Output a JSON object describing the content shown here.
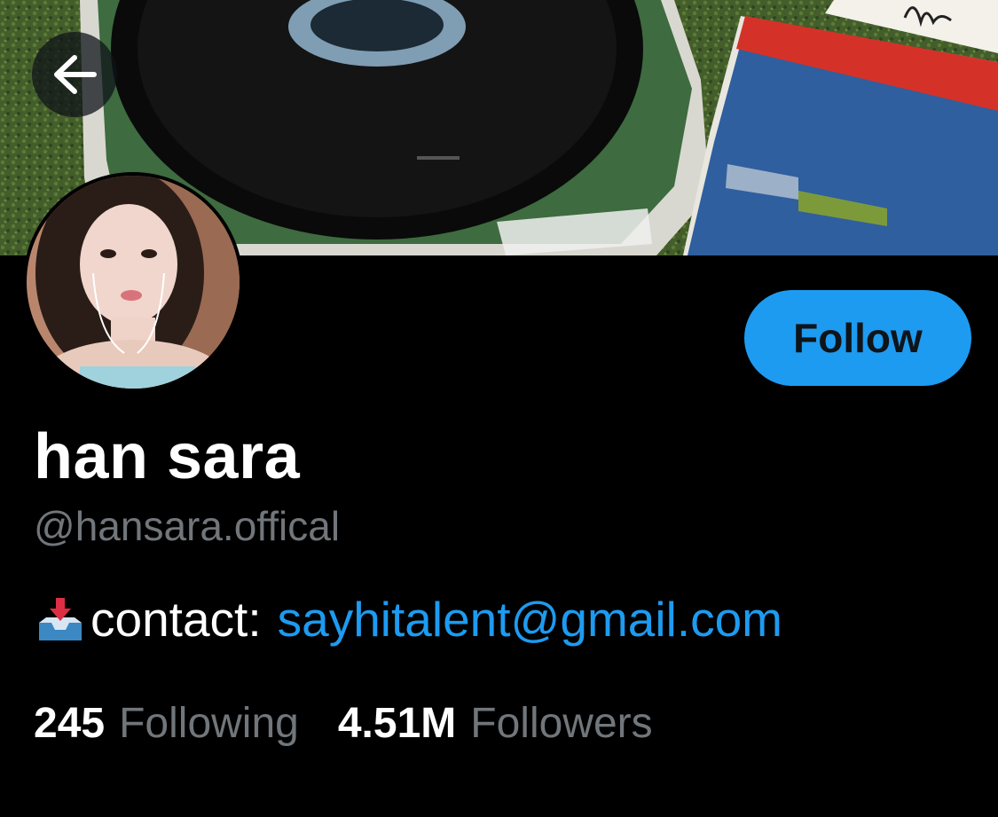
{
  "header": {
    "back_icon": "arrow-left-icon"
  },
  "banner": {
    "description_colors": {
      "grass": "#3f5a2a",
      "record": "#0b0b0b",
      "card_blue": "#3a6fb8",
      "card_red": "#d9322b"
    }
  },
  "profile": {
    "display_name": "han sara",
    "handle": "@hansara.offical",
    "follow_label": "Follow",
    "bio_prefix": "contact:",
    "bio_email": "sayhitalent@gmail.com",
    "bio_icon": "inbox-tray-icon"
  },
  "stats": {
    "following_count": "245",
    "following_label": "Following",
    "followers_count": "4.51M",
    "followers_label": "Followers"
  },
  "colors": {
    "accent": "#1d9bf0",
    "secondary_text": "#71767b",
    "background": "#000000"
  }
}
